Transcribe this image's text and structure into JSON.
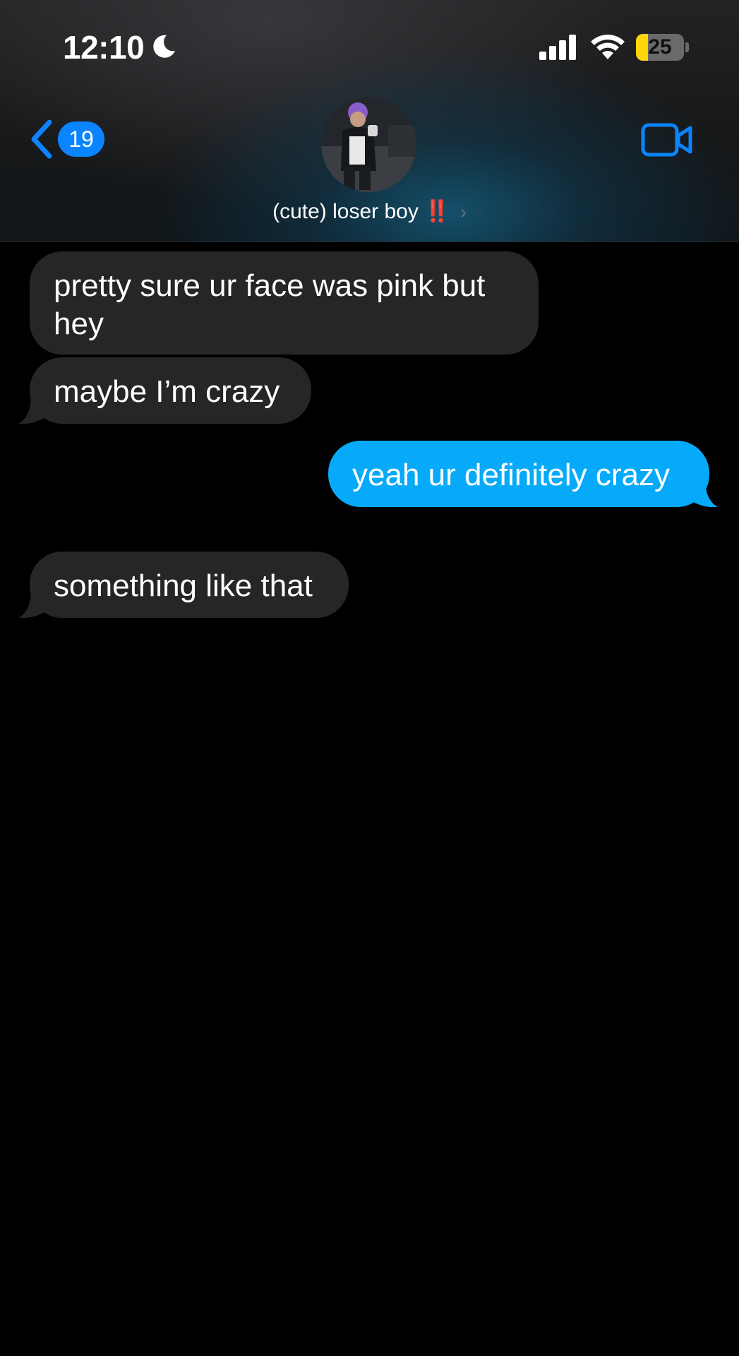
{
  "status_bar": {
    "time": "12:10",
    "focus_icon": "moon-icon",
    "battery_percent": 25,
    "battery_label": "25",
    "battery_color": "#ffd60a"
  },
  "nav": {
    "back_icon": "chevron-left-icon",
    "unread_count": "19",
    "contact_name": "(cute) loser boy",
    "contact_emoji": "‼️",
    "contact_chevron": "›",
    "video_icon": "video-camera-icon",
    "accent_color": "#0a84ff"
  },
  "messages": [
    {
      "direction": "incoming",
      "text": "pretty sure ur face was pink but hey"
    },
    {
      "direction": "incoming",
      "text": "maybe I’m crazy"
    },
    {
      "direction": "outgoing",
      "text": "yeah ur definitely crazy"
    },
    {
      "direction": "incoming",
      "text": "something like that"
    }
  ],
  "colors": {
    "incoming_bubble": "#262628",
    "outgoing_bubble": "#07aaf8",
    "background": "#000000"
  }
}
